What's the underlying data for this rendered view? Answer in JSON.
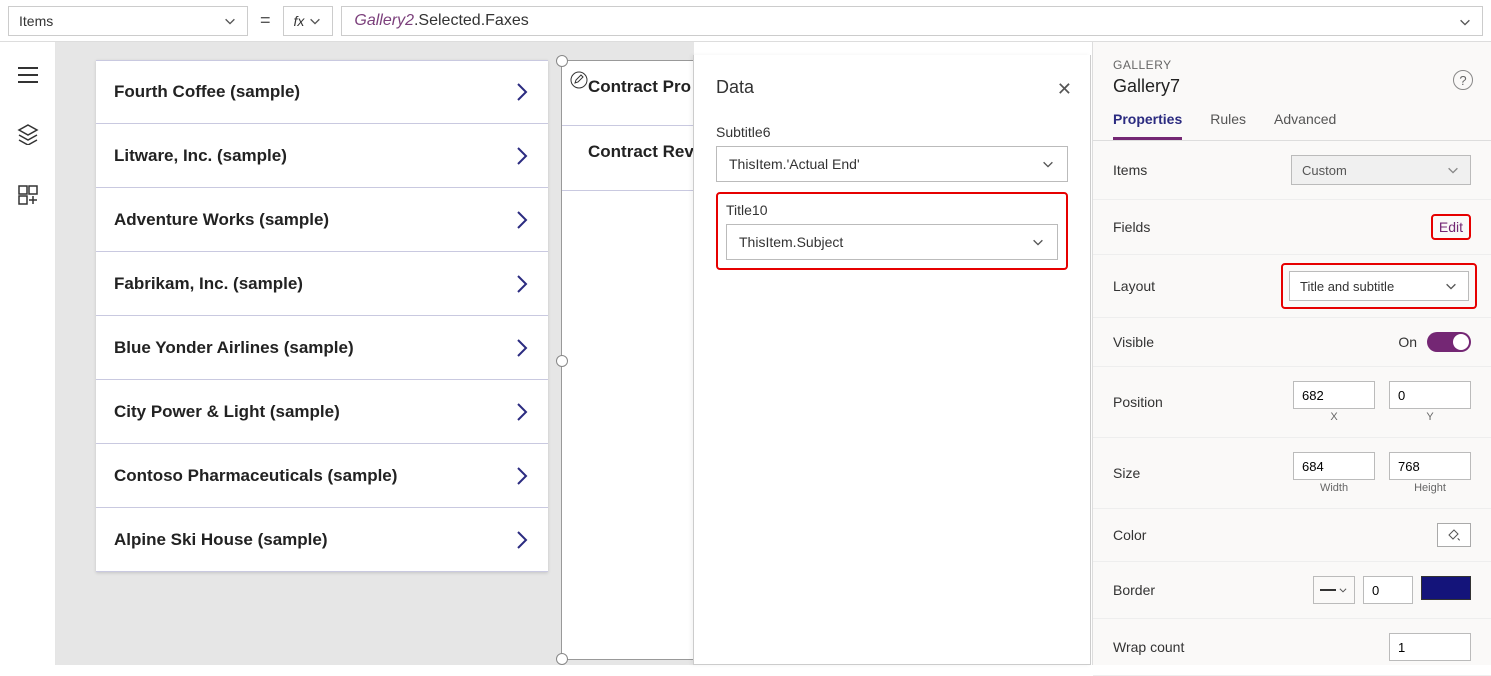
{
  "formula_bar": {
    "property_label": "Items",
    "fx_label": "fx",
    "formula_part1": "Gallery2",
    "formula_part2": ".Selected.Faxes"
  },
  "gallery1": {
    "items": [
      "Fourth Coffee (sample)",
      "Litware, Inc. (sample)",
      "Adventure Works (sample)",
      "Fabrikam, Inc. (sample)",
      "Blue Yonder Airlines (sample)",
      "City Power & Light (sample)",
      "Contoso Pharmaceuticals (sample)",
      "Alpine Ski House (sample)"
    ]
  },
  "gallery2": {
    "items": [
      "Contract Pro",
      "Contract Rev"
    ]
  },
  "data_panel": {
    "title": "Data",
    "fields": [
      {
        "label": "Subtitle6",
        "value": "ThisItem.'Actual End'"
      },
      {
        "label": "Title10",
        "value": "ThisItem.Subject"
      }
    ]
  },
  "props_panel": {
    "pretitle": "GALLERY",
    "title": "Gallery7",
    "tabs": [
      "Properties",
      "Rules",
      "Advanced"
    ],
    "rows": {
      "items_label": "Items",
      "items_value": "Custom",
      "fields_label": "Fields",
      "fields_action": "Edit",
      "layout_label": "Layout",
      "layout_value": "Title and subtitle",
      "visible_label": "Visible",
      "visible_state": "On",
      "position_label": "Position",
      "position_x": "682",
      "position_y": "0",
      "position_x_sub": "X",
      "position_y_sub": "Y",
      "size_label": "Size",
      "size_w": "684",
      "size_h": "768",
      "size_w_sub": "Width",
      "size_h_sub": "Height",
      "color_label": "Color",
      "border_label": "Border",
      "border_width": "0",
      "wrap_label": "Wrap count",
      "wrap_value": "1"
    }
  }
}
